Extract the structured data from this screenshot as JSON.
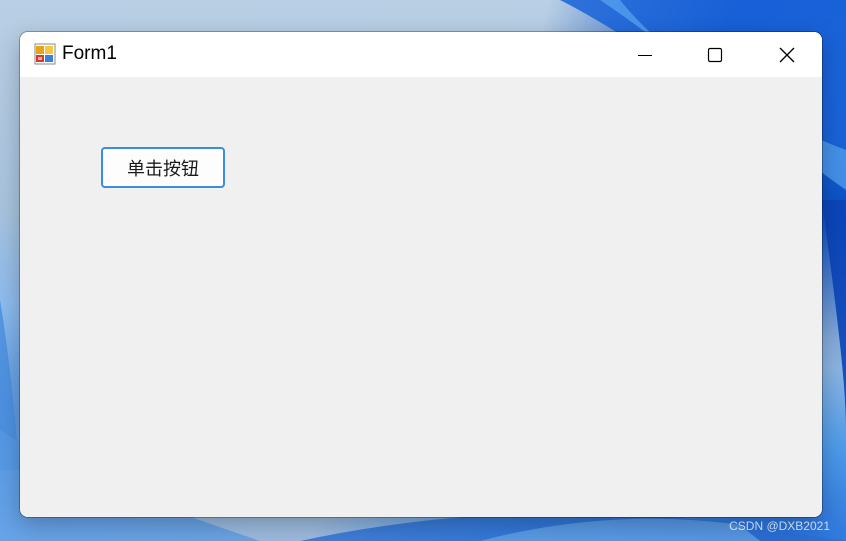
{
  "window": {
    "title": "Form1"
  },
  "form": {
    "button_label": "单击按钮"
  },
  "watermark": {
    "text": "CSDN @DXB2021"
  },
  "icons": {
    "app": "windows-forms-app-icon",
    "minimize": "minimize-icon",
    "maximize": "maximize-icon",
    "close": "close-icon"
  },
  "colors": {
    "client_background": "#f0f0f0",
    "titlebar_background": "#ffffff",
    "button_border_focus": "#3c8de0"
  }
}
